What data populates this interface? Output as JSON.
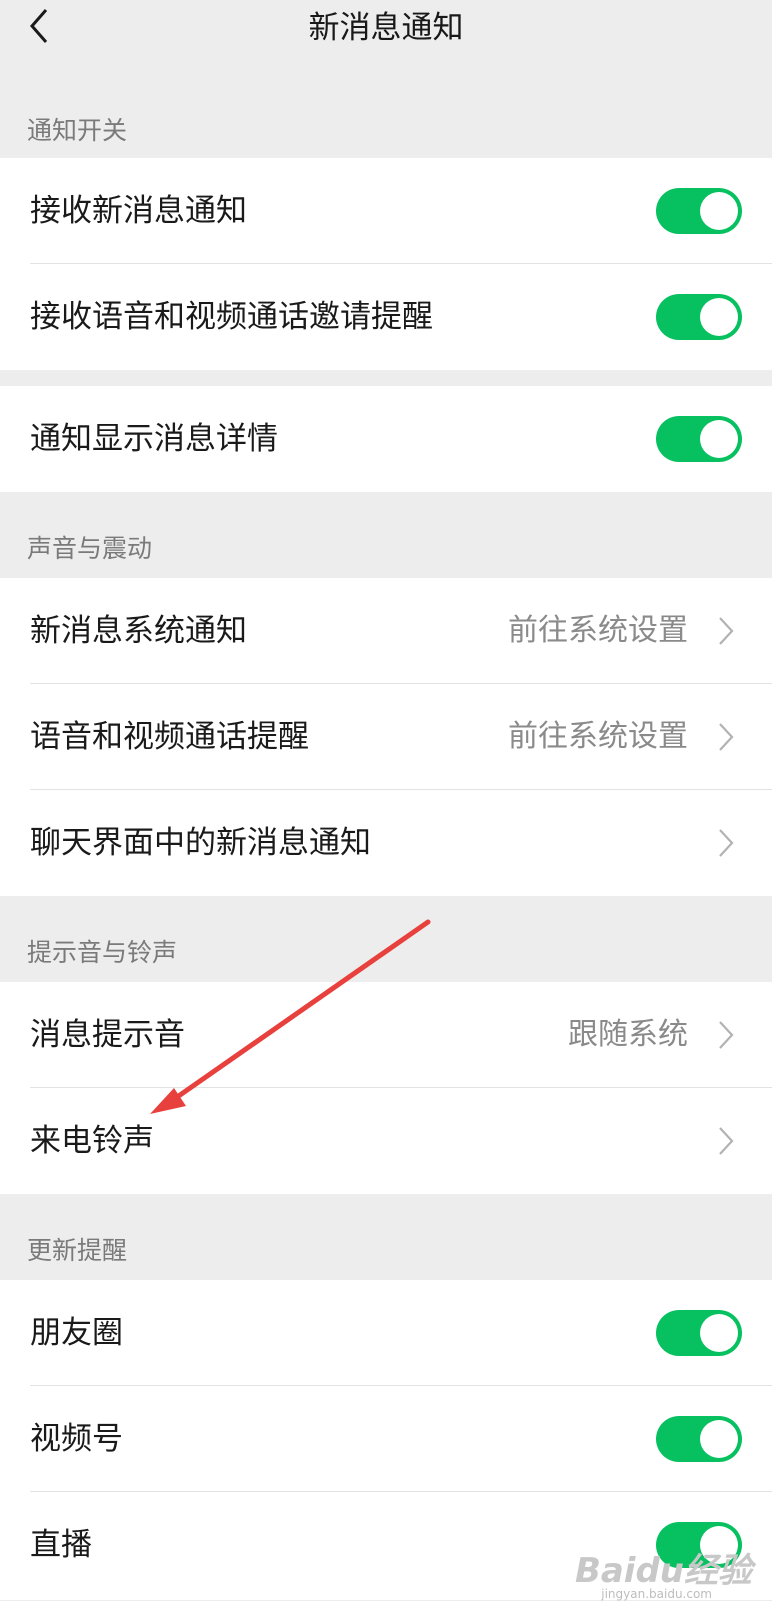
{
  "header": {
    "title": "新消息通知",
    "back": "back-icon"
  },
  "sections": {
    "notify": {
      "label": "通知开关"
    },
    "sound": {
      "label": "声音与震动"
    },
    "ring": {
      "label": "提示音与铃声"
    },
    "update": {
      "label": "更新提醒"
    }
  },
  "rows": {
    "receive_new": {
      "label": "接收新消息通知",
      "enabled": true
    },
    "receive_call": {
      "label": "接收语音和视频通话邀请提醒",
      "enabled": true
    },
    "show_detail": {
      "label": "通知显示消息详情",
      "enabled": true
    },
    "sys_notify": {
      "label": "新消息系统通知",
      "value": "前往系统设置"
    },
    "call_remind": {
      "label": "语音和视频通话提醒",
      "value": "前往系统设置"
    },
    "chat_notify": {
      "label": "聊天界面中的新消息通知"
    },
    "msg_tone": {
      "label": "消息提示音",
      "value": "跟随系统"
    },
    "ringtone": {
      "label": "来电铃声"
    },
    "moments": {
      "label": "朋友圈",
      "enabled": true
    },
    "channels": {
      "label": "视频号",
      "enabled": true
    },
    "live": {
      "label": "直播",
      "enabled": true
    }
  },
  "colors": {
    "accent": "#07c160",
    "annotation_arrow": "#e8403c"
  },
  "watermark": {
    "brand": "Baidu经验",
    "url": "jingyan.baidu.com"
  }
}
